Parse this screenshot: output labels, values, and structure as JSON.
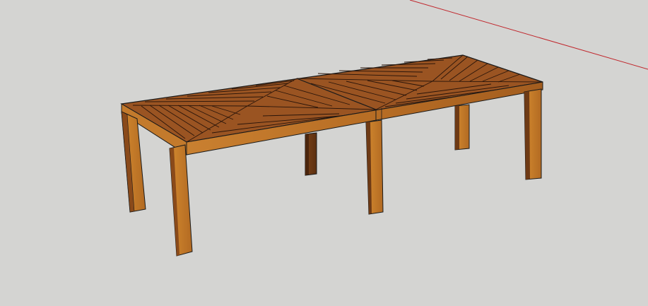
{
  "app": {
    "view": "3d-model-viewport",
    "model": "wooden-table",
    "background_color": "#d4d4d2",
    "axis_color": "#c0262c",
    "wood_top_color": "#9a5422",
    "wood_side_color": "#c6782a",
    "wood_dark_color": "#6e3a15",
    "edge_color": "#1a1a1a"
  }
}
